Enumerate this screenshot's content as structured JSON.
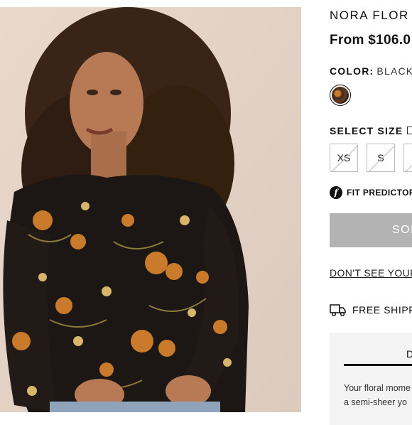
{
  "product": {
    "title": "NORA FLOR",
    "price": "From $106.0",
    "color_label": "COLOR:",
    "color_value": "BLACK",
    "select_size_label": "SELECT SIZE",
    "sizes": [
      "XS",
      "S"
    ],
    "fit_predictor_label": "FIT PREDICTOR",
    "sold_out_label": "SOLD",
    "dont_see_size_link": "DON'T SEE YOUR",
    "free_shipping_label": "FREE SHIPPI",
    "description": {
      "tab_label": "D",
      "line1": "Your floral mome",
      "line2": "a semi-sheer yo"
    }
  },
  "colors": {
    "sold_out_bg": "#b3b3b3",
    "accent_text": "#111111"
  }
}
